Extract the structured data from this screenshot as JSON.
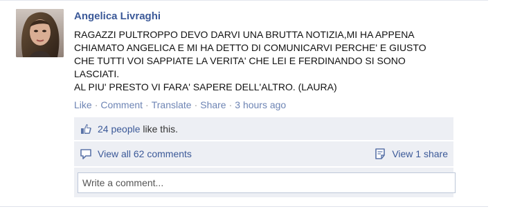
{
  "story": {
    "author": "Angelica Livraghi",
    "message_lines": [
      "RAGAZZI PULTROPPO DEVO DARVI UNA BRUTTA NOTIZIA,MI HA APPENA",
      "CHIAMATO ANGELICA E MI HA DETTO DI COMUNICARVI PERCHE' E GIUSTO",
      "CHE TUTTI VOI SAPPIATE LA VERITA' CHE LEI E FERDINANDO SI SONO",
      "LASCIATI.",
      "AL PIU' PRESTO VI FARA' SAPERE DELL'ALTRO. (LAURA)"
    ]
  },
  "actions": {
    "like": "Like",
    "comment": "Comment",
    "translate": "Translate",
    "share": "Share",
    "separator": "·",
    "time": "3 hours ago"
  },
  "likes": {
    "count_text": "24 people",
    "suffix": "like this."
  },
  "comments": {
    "view_all": "View all 62 comments",
    "view_share": "View 1 share"
  },
  "composer": {
    "placeholder": "Write a comment..."
  },
  "colors": {
    "link": "#3b5998",
    "muted_link": "#6d84b4",
    "panel_bg": "#edeff4",
    "input_border": "#bdc7d8"
  },
  "icons": {
    "likes": "thumbs-up-icon",
    "comments": "speech-bubble-icon",
    "share": "share-note-icon"
  }
}
